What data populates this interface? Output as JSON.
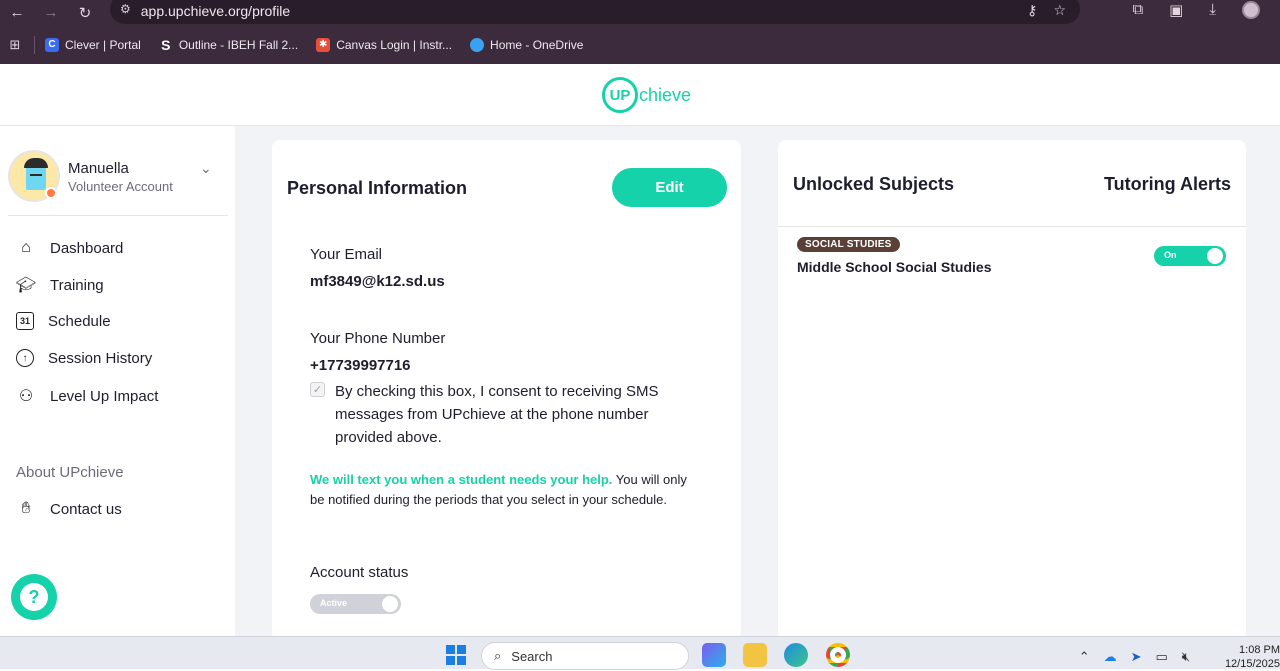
{
  "browser": {
    "url": "app.upchieve.org/profile",
    "bookmarks": [
      {
        "label": "Clever | Portal",
        "icon": "clever-icon",
        "color": "#3b6cf0"
      },
      {
        "label": "Outline - IBEH Fall 2...",
        "icon": "outline-icon",
        "color": "#ffffff"
      },
      {
        "label": "Canvas Login | Instr...",
        "icon": "canvas-icon",
        "color": "#e94e3b"
      },
      {
        "label": "Home - OneDrive",
        "icon": "onedrive-icon",
        "color": "#3aa0f0"
      }
    ]
  },
  "header": {
    "logo_up": "UP",
    "logo_rest": "chieve"
  },
  "sidebar": {
    "user_name": "Manuella",
    "account_type": "Volunteer Account",
    "items": [
      {
        "label": "Dashboard",
        "icon": "home-icon"
      },
      {
        "label": "Training",
        "icon": "graduation-cap-icon"
      },
      {
        "label": "Schedule",
        "icon": "calendar-icon",
        "icon_text": "31"
      },
      {
        "label": "Session History",
        "icon": "clock-icon"
      },
      {
        "label": "Level Up Impact",
        "icon": "people-icon"
      }
    ],
    "about_label": "About UPchieve",
    "contact_label": "Contact us"
  },
  "personal": {
    "title": "Personal Information",
    "edit_label": "Edit",
    "email_label": "Your Email",
    "email_value": "mf3849@k12.sd.us",
    "phone_label": "Your Phone Number",
    "phone_value": "+17739997716",
    "consent_text": "By checking this box, I consent to receiving SMS messages from UPchieve at the phone number provided above.",
    "consent_checked": true,
    "notice_highlight": "We will text you when a student needs your help.",
    "notice_rest": " You will only be notified during the periods that you select in your schedule.",
    "status_label": "Account status",
    "status_toggle": "Active"
  },
  "subjects": {
    "title": "Unlocked Subjects",
    "alerts_title": "Tutoring Alerts",
    "items": [
      {
        "badge": "SOCIAL STUDIES",
        "name": "Middle School Social Studies",
        "alert_toggle": "On"
      }
    ]
  },
  "taskbar": {
    "search_placeholder": "Search",
    "time": "1:08 PM",
    "date": "12/15/2025"
  },
  "colors": {
    "accent": "#16d2aa",
    "badge_bg": "#5a4036",
    "chrome": "#3c2a3d"
  }
}
